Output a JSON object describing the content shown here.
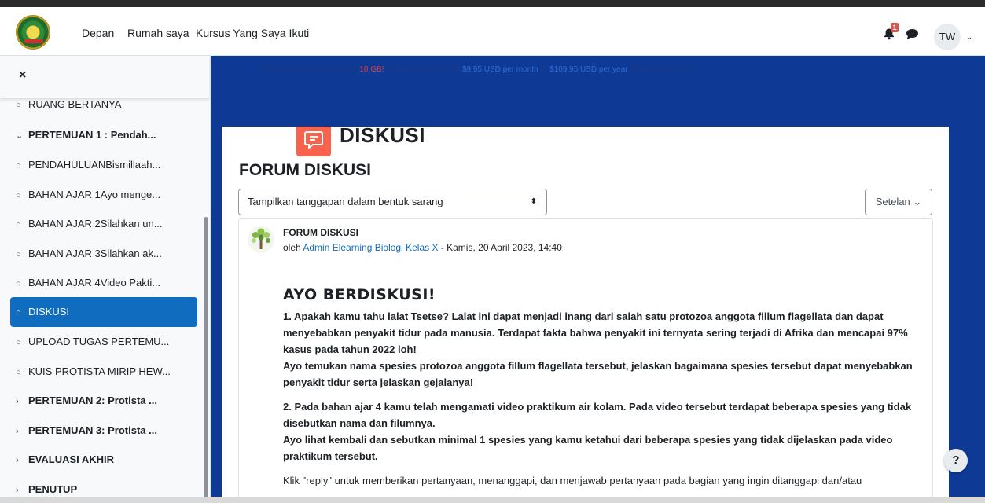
{
  "navbar": {
    "links": [
      "Depan",
      "Rumah saya",
      "Kursus Yang Saya Ikuti"
    ],
    "notification_count": "1",
    "user_initials": "TW"
  },
  "sidebar": {
    "close_label": "×",
    "items": [
      {
        "label": "RUANG BERTANYA",
        "icon": "circle-icon",
        "type": "activity"
      },
      {
        "label": "PERTEMUAN 1 : Pendah...",
        "icon": "chevron-down-icon",
        "type": "section"
      },
      {
        "label": "PENDAHULUANBismillaah...",
        "icon": "circle-icon",
        "type": "activity"
      },
      {
        "label": "BAHAN AJAR 1Ayo menge...",
        "icon": "circle-icon",
        "type": "activity"
      },
      {
        "label": "BAHAN AJAR 2Silahkan un...",
        "icon": "circle-icon",
        "type": "activity"
      },
      {
        "label": "BAHAN AJAR 3Silahkan ak...",
        "icon": "circle-icon",
        "type": "activity"
      },
      {
        "label": "BAHAN AJAR 4Video Pakti...",
        "icon": "circle-icon",
        "type": "activity"
      },
      {
        "label": "DISKUSI",
        "icon": "circle-icon",
        "type": "activity",
        "active": true
      },
      {
        "label": "UPLOAD TUGAS PERTEMU...",
        "icon": "circle-icon",
        "type": "activity"
      },
      {
        "label": "KUIS PROTISTA MIRIP HEW...",
        "icon": "circle-icon",
        "type": "activity"
      },
      {
        "label": "PERTEMUAN 2: Protista ...",
        "icon": "chevron-right-icon",
        "type": "section"
      },
      {
        "label": "PERTEMUAN 3: Protista ...",
        "icon": "chevron-right-icon",
        "type": "section"
      },
      {
        "label": "EVALUASI AKHIR",
        "icon": "chevron-right-icon",
        "type": "section"
      },
      {
        "label": "PENUTUP",
        "icon": "chevron-right-icon",
        "type": "section"
      }
    ]
  },
  "ad": {
    "part1": "Remove advertising and get ",
    "highlight": "10 GB!",
    "part2": " of disk space for only ",
    "price_month": "$9.95 USD per month",
    "part3": " or ",
    "price_year": "$109.95 USD per year",
    "part4": " (plus local taxes)."
  },
  "activity": {
    "type_label": "DISKUSI",
    "page_title": "FORUM DISKUSI",
    "display_select": "Tampilkan tanggapan dalam bentuk sarang",
    "settings_button": "Setelan"
  },
  "post": {
    "title": "FORUM DISKUSI",
    "by": "oleh ",
    "author": "Admin Elearning Biologi Kelas X",
    "date": " - Kamis, 20 April 2023, 14:40",
    "heading": "AYO BERDISKUSI!",
    "q1a": "1. Apakah kamu tahu lalat Tsetse? Lalat ini dapat menjadi inang dari salah satu protozoa anggota fillum flagellata dan dapat menyebabkan penyakit tidur pada manusia. Terdapat fakta bahwa penyakit ini ternyata sering  terjadi di Afrika dan mencapai 97% kasus pada tahun 2022 loh!",
    "q1b": "Ayo temukan nama spesies protozoa anggota fillum flagellata tersebut, jelaskan bagaimana spesies tersebut dapat menyebabkan penyakit tidur serta jelaskan gejalanya!",
    "q2a": "2. Pada bahan ajar 4 kamu telah mengamati video praktikum air kolam. Pada video tersebut terdapat beberapa spesies yang tidak disebutkan nama dan filumnya.",
    "q2b": "Ayo lihat kembali dan sebutkan minimal 1 spesies yang kamu ketahui dari beberapa spesies yang tidak dijelaskan pada video praktikum tersebut.",
    "note": "Klik \"reply\" untuk memberikan pertanyaan, menanggapi, dan menjawab pertanyaan pada bagian yang ingin ditanggapi dan/atau"
  },
  "help_label": "?"
}
